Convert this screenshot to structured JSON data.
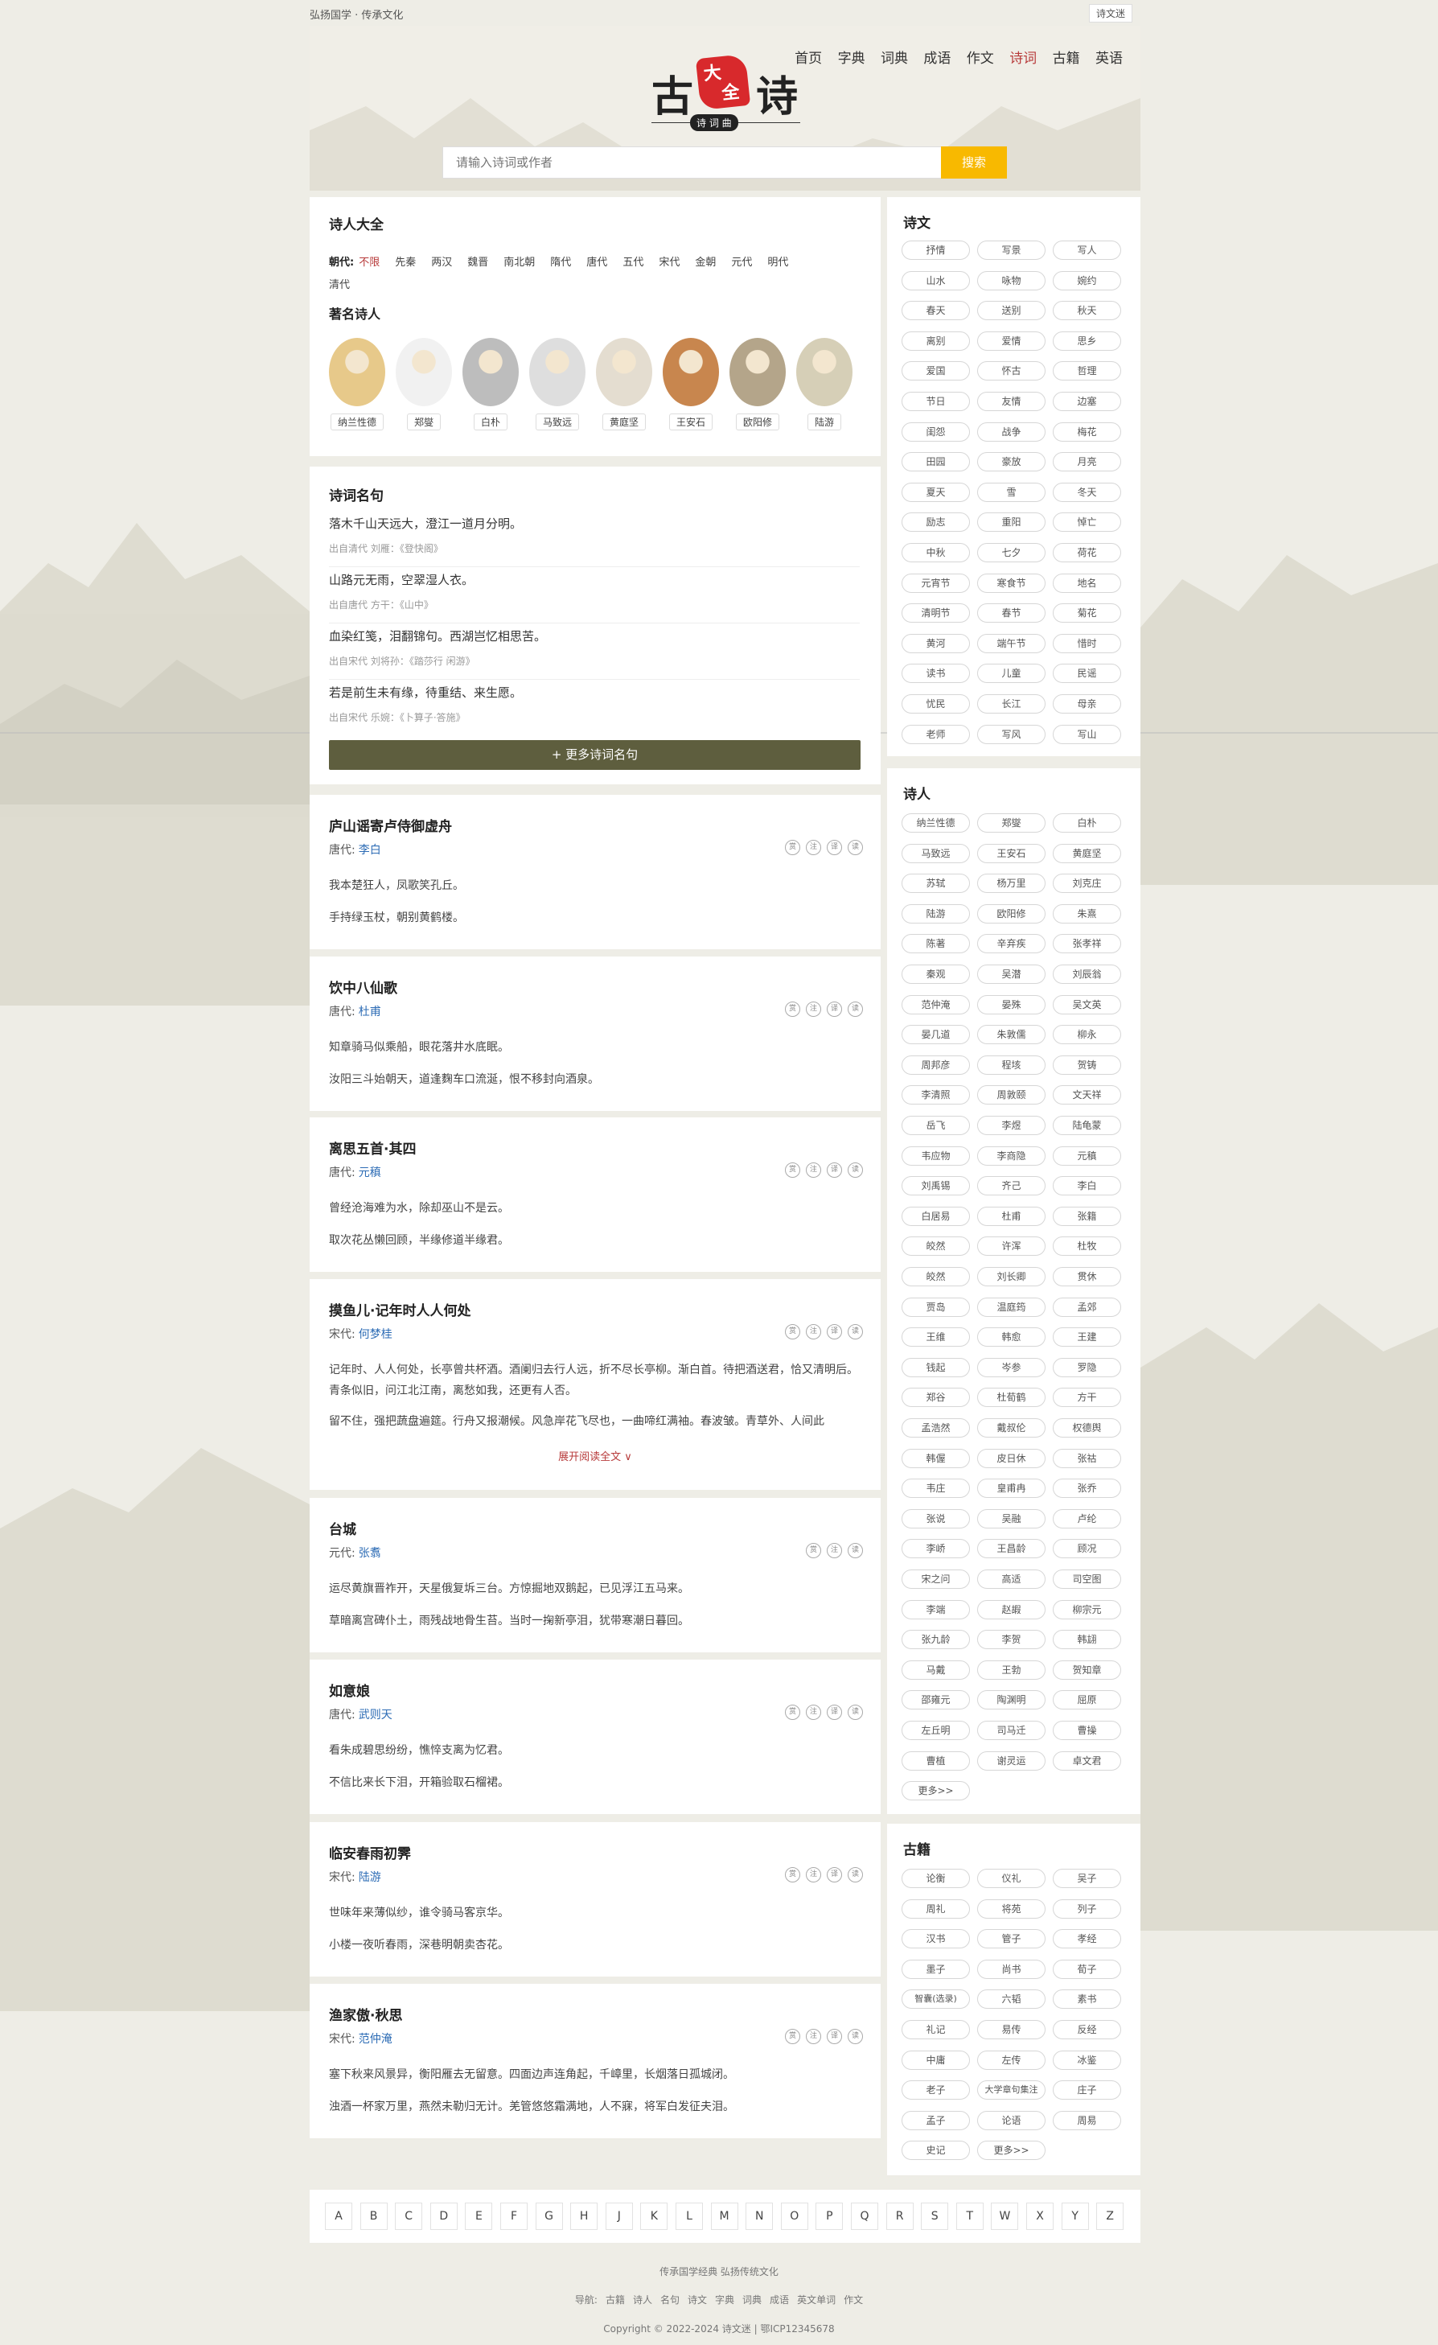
{
  "topbar": {
    "slogan": "弘扬国学 · 传承文化",
    "link": "诗文迷"
  },
  "nav": [
    "首页",
    "字典",
    "词典",
    "成语",
    "作文",
    "诗词",
    "古籍",
    "英语"
  ],
  "nav_active": 5,
  "logo": {
    "main1": "古",
    "main2": "诗",
    "badge1": "大",
    "badge2": "全",
    "sub": "诗 词 曲"
  },
  "search": {
    "placeholder": "请输入诗词或作者",
    "button": "搜索"
  },
  "poets_section": {
    "title": "诗人大全",
    "dynasty_label": "朝代:",
    "dynasties": [
      "不限",
      "先秦",
      "两汉",
      "魏晋",
      "南北朝",
      "隋代",
      "唐代",
      "五代",
      "宋代",
      "金朝",
      "元代",
      "明代",
      "清代"
    ],
    "famous_title": "著名诗人",
    "famous": [
      "纳兰性德",
      "郑燮",
      "白朴",
      "马致远",
      "黄庭坚",
      "王安石",
      "欧阳修",
      "陆游"
    ]
  },
  "quotes_section": {
    "title": "诗词名句",
    "items": [
      {
        "text": "落木千山天远大，澄江一道月分明。",
        "src": "出自清代 刘雁：《登快阁》"
      },
      {
        "text": "山路元无雨，空翠湿人衣。",
        "src": "出自唐代 方干：《山中》"
      },
      {
        "text": "血染红笺，泪翻锦句。西湖岂忆相思苦。",
        "src": "出自宋代 刘将孙：《踏莎行 闲游》"
      },
      {
        "text": "若是前生未有缘，待重结、来生愿。",
        "src": "出自宋代 乐婉：《卜算子·答施》"
      }
    ],
    "more": "+ 更多诗词名句"
  },
  "poems": [
    {
      "title": "庐山谣寄卢侍御虚舟",
      "dynasty": "唐代:",
      "author": "李白",
      "lines": [
        "我本楚狂人，凤歌笑孔丘。",
        "手持绿玉杖，朝别黄鹤楼。"
      ]
    },
    {
      "title": "饮中八仙歌",
      "dynasty": "唐代:",
      "author": "杜甫",
      "lines": [
        "知章骑马似乘船，眼花落井水底眠。",
        "汝阳三斗始朝天，道逢麴车口流涎，恨不移封向酒泉。"
      ]
    },
    {
      "title": "离思五首·其四",
      "dynasty": "唐代:",
      "author": "元稹",
      "lines": [
        "曾经沧海难为水，除却巫山不是云。",
        "取次花丛懒回顾，半缘修道半缘君。"
      ]
    },
    {
      "title": "摸鱼儿·记年时人人何处",
      "dynasty": "宋代:",
      "author": "何梦桂",
      "lines": [
        "记年时、人人何处，长亭曾共杯酒。酒阑归去行人远，折不尽长亭柳。渐白首。待把酒送君，恰又清明后。青条似旧，问江北江南，离愁如我，还更有人否。",
        "留不住，强把蔬盘遍筵。行舟又报潮候。风急岸花飞尽也，一曲啼红满袖。春波皱。青草外、人间此"
      ],
      "expand": "展开阅读全文 ∨"
    },
    {
      "title": "台城",
      "dynasty": "元代:",
      "author": "张翥",
      "lines": [
        "运尽黄旗晋祚开，天星俄复坼三台。方惊掘地双鹅起，已见浮江五马来。",
        "草暗离宫碑仆土，雨残战地骨生苔。当时一掬新亭泪，犹带寒潮日暮回。"
      ]
    },
    {
      "title": "如意娘",
      "dynasty": "唐代:",
      "author": "武则天",
      "lines": [
        "看朱成碧思纷纷，憔悴支离为忆君。",
        "不信比来长下泪，开箱验取石榴裙。"
      ]
    },
    {
      "title": "临安春雨初霁",
      "dynasty": "宋代:",
      "author": "陆游",
      "lines": [
        "世味年来薄似纱，谁令骑马客京华。",
        "小楼一夜听春雨，深巷明朝卖杏花。"
      ]
    },
    {
      "title": "渔家傲·秋思",
      "dynasty": "宋代:",
      "author": "范仲淹",
      "lines": [
        "塞下秋来风景异，衡阳雁去无留意。四面边声连角起，千嶂里，长烟落日孤城闭。",
        "浊酒一杯家万里，燕然未勒归无计。羌管悠悠霜满地，人不寐，将军白发征夫泪。"
      ]
    }
  ],
  "poem_icon_labels": [
    "赏",
    "注",
    "译",
    "读"
  ],
  "poem_icon_labels_short": [
    "赏",
    "注",
    "读"
  ],
  "sidebar_poetry": {
    "title": "诗文",
    "tags": [
      "抒情",
      "写景",
      "写人",
      "山水",
      "咏物",
      "婉约",
      "春天",
      "送别",
      "秋天",
      "离别",
      "爱情",
      "思乡",
      "爱国",
      "怀古",
      "哲理",
      "节日",
      "友情",
      "边塞",
      "闺怨",
      "战争",
      "梅花",
      "田园",
      "豪放",
      "月亮",
      "夏天",
      "雪",
      "冬天",
      "励志",
      "重阳",
      "悼亡",
      "中秋",
      "七夕",
      "荷花",
      "元宵节",
      "寒食节",
      "地名",
      "清明节",
      "春节",
      "菊花",
      "黄河",
      "端午节",
      "惜时",
      "读书",
      "儿童",
      "民谣",
      "忧民",
      "长江",
      "母亲",
      "老师",
      "写风",
      "写山"
    ]
  },
  "sidebar_poets": {
    "title": "诗人",
    "tags": [
      "纳兰性德",
      "郑燮",
      "白朴",
      "马致远",
      "王安石",
      "黄庭坚",
      "苏轼",
      "杨万里",
      "刘克庄",
      "陆游",
      "欧阳修",
      "朱熹",
      "陈著",
      "辛弃疾",
      "张孝祥",
      "秦观",
      "吴潜",
      "刘辰翁",
      "范仲淹",
      "晏殊",
      "吴文英",
      "晏几道",
      "朱敦儒",
      "柳永",
      "周邦彦",
      "程垓",
      "贺铸",
      "李清照",
      "周敦颐",
      "文天祥",
      "岳飞",
      "李煜",
      "陆龟蒙",
      "韦应物",
      "李商隐",
      "元稹",
      "刘禹锡",
      "齐己",
      "李白",
      "白居易",
      "杜甫",
      "张籍",
      "皎然",
      "许浑",
      "杜牧",
      "皎然",
      "刘长卿",
      "贯休",
      "贾岛",
      "温庭筠",
      "孟郊",
      "王维",
      "韩愈",
      "王建",
      "钱起",
      "岑参",
      "罗隐",
      "郑谷",
      "杜荀鹤",
      "方干",
      "孟浩然",
      "戴叔伦",
      "权德舆",
      "韩偓",
      "皮日休",
      "张祜",
      "韦庄",
      "皇甫冉",
      "张乔",
      "张说",
      "吴融",
      "卢纶",
      "李峤",
      "王昌龄",
      "顾况",
      "宋之问",
      "高适",
      "司空图",
      "李端",
      "赵嘏",
      "柳宗元",
      "张九龄",
      "李贺",
      "韩翃",
      "马戴",
      "王勃",
      "贺知章",
      "邵雍元",
      "陶渊明",
      "屈原",
      "左丘明",
      "司马迁",
      "曹操",
      "曹植",
      "谢灵运",
      "卓文君"
    ],
    "more": "更多>>"
  },
  "sidebar_books": {
    "title": "古籍",
    "tags": [
      "论衡",
      "仪礼",
      "吴子",
      "周礼",
      "将苑",
      "列子",
      "汉书",
      "管子",
      "孝经",
      "墨子",
      "尚书",
      "荀子",
      "智囊(选录)",
      "六韬",
      "素书",
      "礼记",
      "易传",
      "反经",
      "中庸",
      "左传",
      "冰鉴",
      "老子",
      "大学章句集注",
      "庄子",
      "孟子",
      "论语",
      "周易",
      "史记"
    ],
    "more": "更多>>"
  },
  "alphabet": [
    "A",
    "B",
    "C",
    "D",
    "E",
    "F",
    "G",
    "H",
    "J",
    "K",
    "L",
    "M",
    "N",
    "O",
    "P",
    "Q",
    "R",
    "S",
    "T",
    "W",
    "X",
    "Y",
    "Z"
  ],
  "footer": {
    "tagline": "传承国学经典 弘扬传统文化",
    "nav_label": "导航:",
    "nav": [
      "古籍",
      "诗人",
      "名句",
      "诗文",
      "字典",
      "词典",
      "成语",
      "英文单词",
      "作文"
    ],
    "copyright": "Copyright © 2022-2024 诗文迷 | 鄂ICP12345678"
  }
}
